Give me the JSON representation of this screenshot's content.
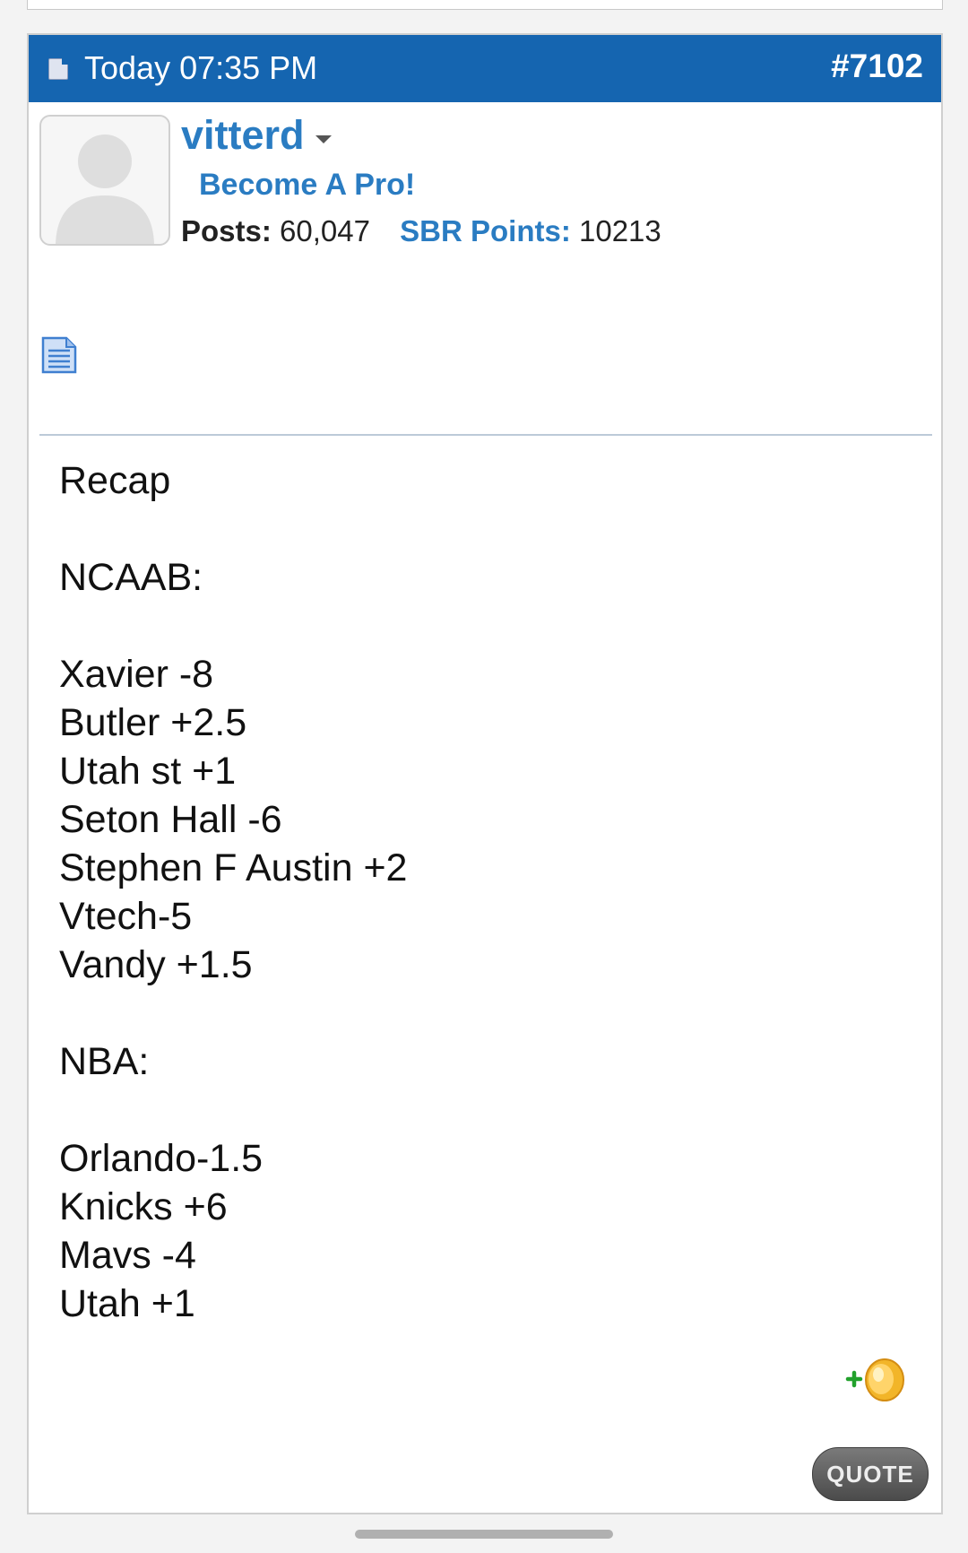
{
  "post": {
    "date": "Today 07:35 PM",
    "number": "#7102",
    "username": "vitterd",
    "user_title": "Become A Pro!",
    "posts_label": "Posts:",
    "posts_value": "60,047",
    "points_label": "SBR Points:",
    "points_value": "10213",
    "lines": [
      "Recap",
      "",
      "NCAAB:",
      "",
      "Xavier -8",
      "Butler +2.5",
      "Utah st +1",
      "Seton Hall -6",
      "Stephen F Austin +2",
      "Vtech-5",
      "Vandy +1.5",
      "",
      "NBA:",
      "",
      "Orlando-1.5",
      "Knicks +6",
      "Mavs -4",
      "Utah +1"
    ],
    "quote_label": "QUOTE"
  },
  "colors": {
    "header_bg": "#1565b0",
    "link_blue": "#2a7cc2"
  },
  "icons": [
    "document-icon",
    "avatar-placeholder-icon",
    "chevron-down-icon",
    "add-points-icon"
  ]
}
